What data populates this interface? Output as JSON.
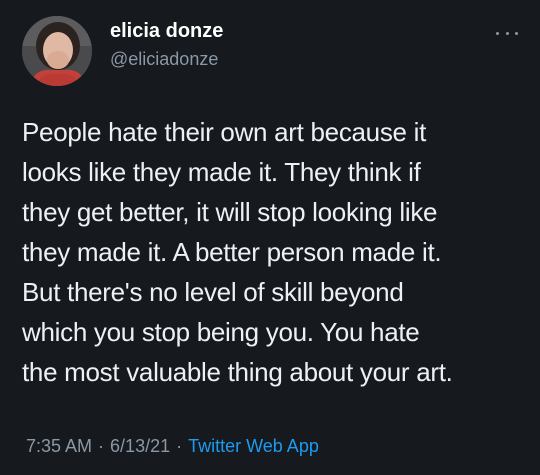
{
  "tweet": {
    "author": {
      "display_name": "elicia donze",
      "handle": "@eliciadonze",
      "avatar_icon": "user-avatar-photo"
    },
    "more_icon": "more-dots-icon",
    "text_lines": [
      "People hate their own art because it",
      "looks like they made it. They think if",
      "they get better, it will stop looking like",
      "they made it. A better person made it.",
      "But there's no level of skill beyond",
      "which you stop being you. You hate",
      "the most valuable thing about your art."
    ],
    "time": "7:35 AM",
    "separator": "·",
    "date": "6/13/21",
    "source": "Twitter Web App"
  },
  "colors": {
    "background": "#16191e",
    "text_primary": "#eef1f3",
    "text_secondary": "#8b98a5",
    "link_accent": "#1d9bf0"
  }
}
